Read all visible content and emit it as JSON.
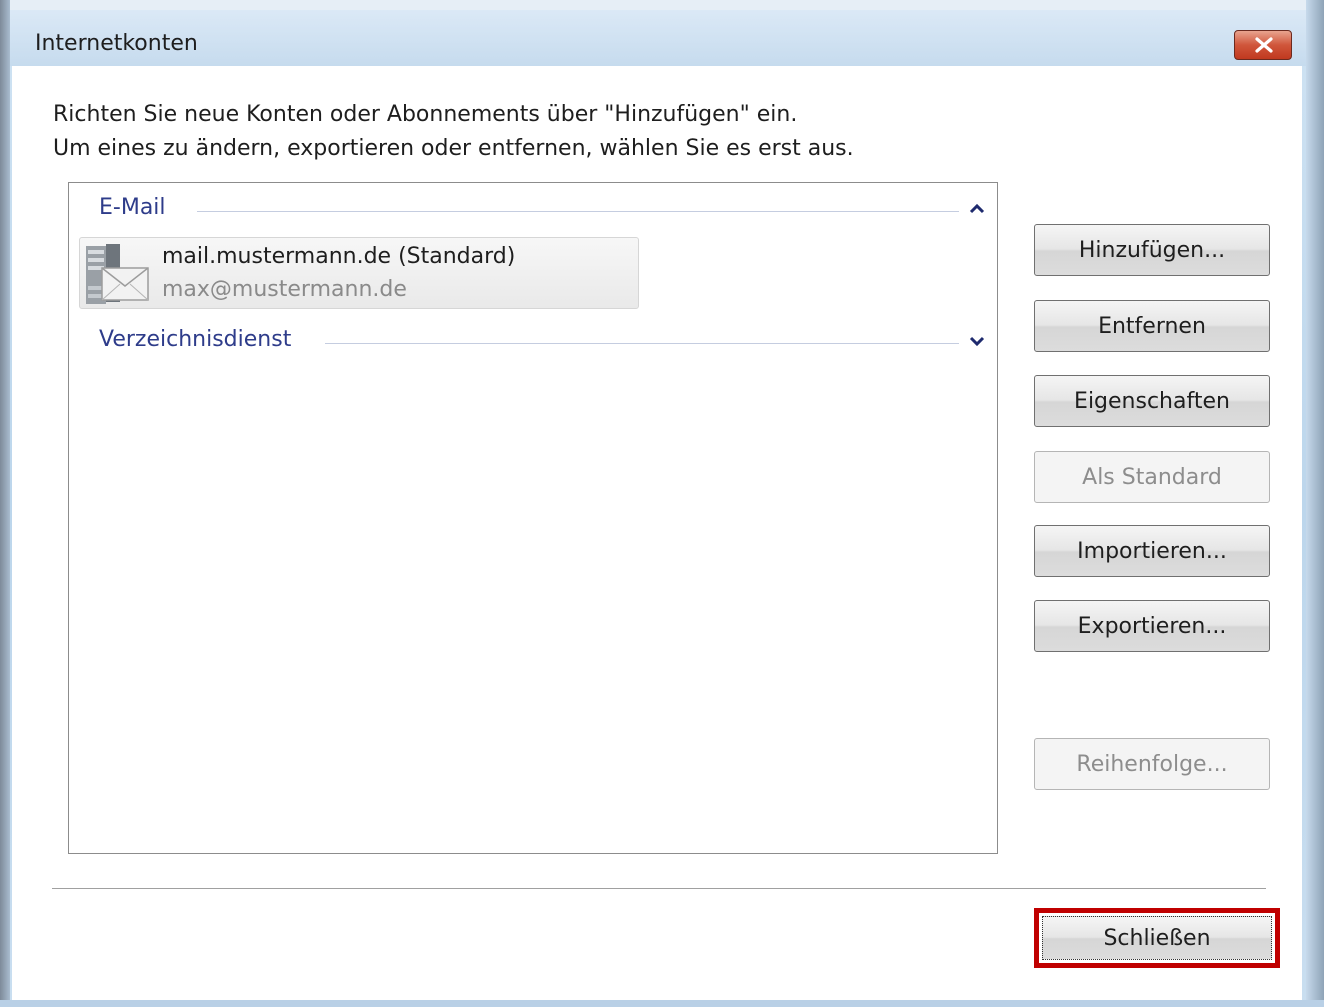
{
  "window": {
    "title": "Internetkonten"
  },
  "intro": {
    "line1": "Richten Sie neue Konten oder Abonnements über \"Hinzufügen\" ein.",
    "line2": "Um eines zu ändern, exportieren oder entfernen, wählen Sie es erst aus."
  },
  "accounts": {
    "groups": [
      {
        "label": "E-Mail",
        "expanded": true,
        "items": [
          {
            "name": "mail.mustermann.de (Standard)",
            "address": "max@mustermann.de",
            "icon": "mail-server-icon"
          }
        ]
      },
      {
        "label": "Verzeichnisdienst",
        "expanded": false,
        "items": []
      }
    ]
  },
  "buttons": {
    "add": "Hinzufügen...",
    "remove": "Entfernen",
    "properties": "Eigenschaften",
    "set_default": "Als Standard",
    "import": "Importieren...",
    "export": "Exportieren...",
    "order": "Reihenfolge...",
    "close": "Schließen"
  },
  "states": {
    "set_default_enabled": false,
    "order_enabled": false
  },
  "colors": {
    "group_label": "#2e3c8a",
    "highlight": "#c00000",
    "close_button": "#c0391f"
  }
}
